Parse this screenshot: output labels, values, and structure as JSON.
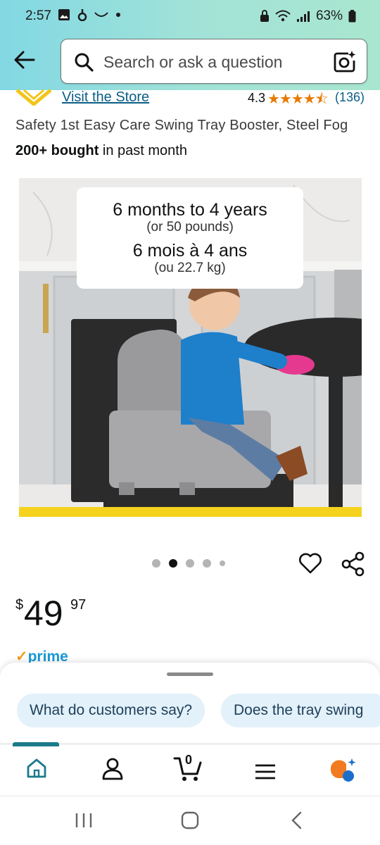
{
  "status_bar": {
    "time": "2:57",
    "battery": "63%",
    "left_icons": [
      "image-icon",
      "cleaner-icon",
      "wave-icon",
      "dot-icon"
    ],
    "right_icons": [
      "vpn-icon",
      "wifi-icon",
      "signal-icon",
      "battery-icon"
    ]
  },
  "header": {
    "search_placeholder": "Search or ask a question"
  },
  "store": {
    "link_text": "Visit the Store",
    "rating": "4.3",
    "stars": "★★★★⯪",
    "review_count": "(136)"
  },
  "product": {
    "title": "Safety 1st Easy Care Swing Tray Booster, Steel Fog",
    "bought_bold": "200+ bought",
    "bought_rest": " in past month",
    "image_overlay": {
      "line1": "6 months to 4 years",
      "line2": "(or 50 pounds)",
      "line3": "6 mois à 4 ans",
      "line4": "(ou 22.7 kg)"
    },
    "carousel": {
      "count": 5,
      "active_index": 1
    },
    "price": {
      "currency": "$",
      "whole": "49",
      "fraction": "97"
    },
    "prime_label": "prime"
  },
  "suggestions": {
    "chips": [
      "What do customers say?",
      "Does the tray swing"
    ]
  },
  "bottom_nav": {
    "items": [
      "home-icon",
      "account-icon",
      "cart-icon",
      "menu-icon",
      "rufus-icon"
    ],
    "active": "home-icon",
    "cart_count": "0"
  },
  "colors": {
    "header_gradient_start": "#82d8e3",
    "header_gradient_end": "#a9e6cf",
    "link": "#0a5e84",
    "stars": "#e67a00",
    "prime": "#1a98d5",
    "chip_bg": "#e2f1fa",
    "nav_active": "#1c7a8c",
    "image_band": "#f5d21d"
  }
}
